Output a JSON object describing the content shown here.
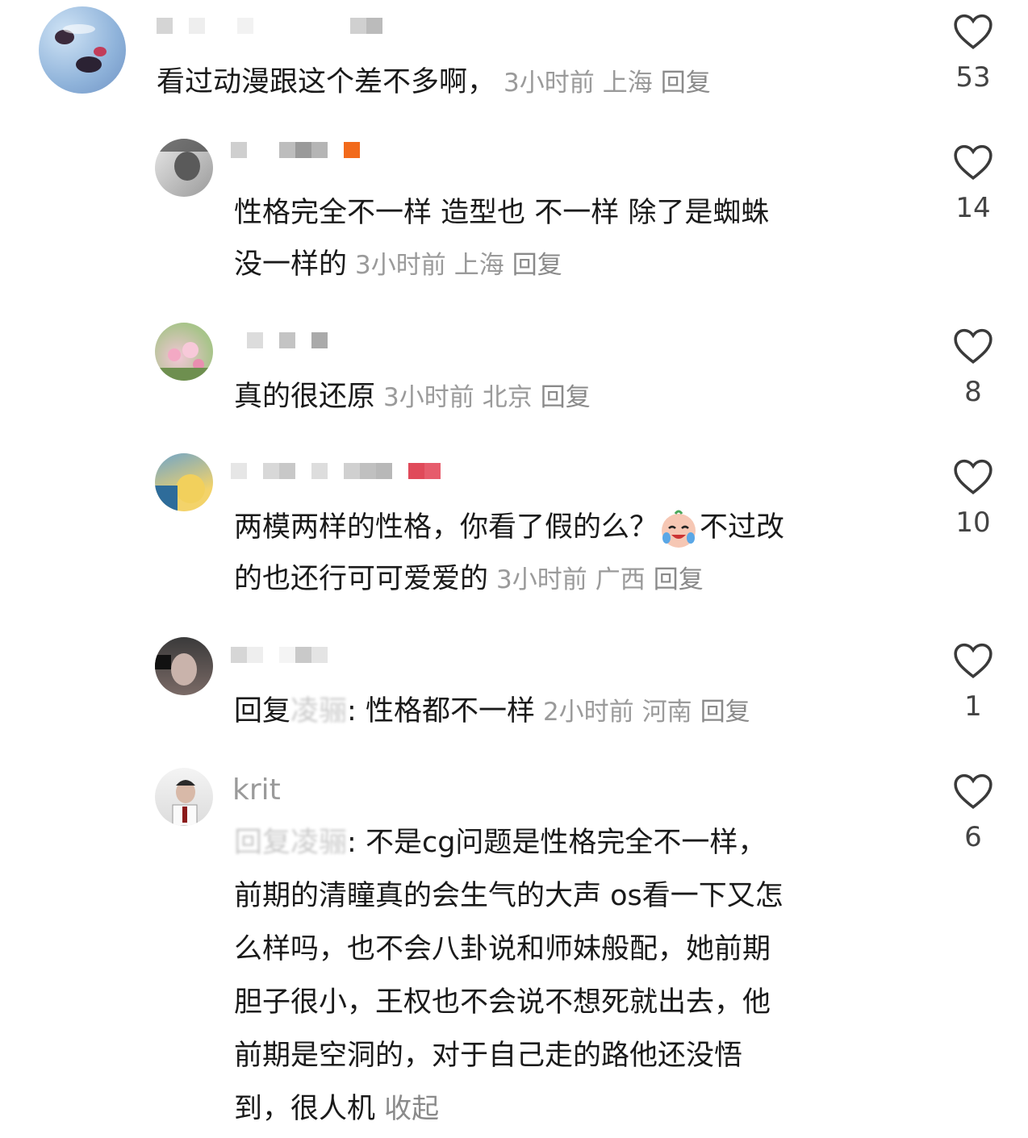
{
  "comments": [
    {
      "username": "",
      "text": "看过动漫跟这个差不多啊，",
      "time": "3小时前",
      "location": "上海",
      "reply_label": "回复",
      "likes": "53"
    },
    {
      "username": "",
      "text_line1": "性格完全不一样 造型也 不一样 除了是蜘蛛",
      "text_line2": "没一样的",
      "time": "3小时前",
      "location": "上海",
      "reply_label": "回复",
      "likes": "14"
    },
    {
      "username": "",
      "text": "真的很还原",
      "time": "3小时前",
      "location": "北京",
      "reply_label": "回复",
      "likes": "8"
    },
    {
      "username": "",
      "text_line1a": "两模两样的性格，你看了假的么？",
      "text_line1b": "不过改",
      "text_line2": "的也还行可可爱爱的",
      "time": "3小时前",
      "location": "广西",
      "reply_label": "回复",
      "likes": "10"
    },
    {
      "username": "",
      "reply_prefix": "回复",
      "reply_target": "凌骊",
      "text": ": 性格都不一样",
      "time": "2小时前",
      "location": "河南",
      "reply_label": "回复",
      "likes": "1"
    },
    {
      "username": "krit",
      "reply_prefix": "回复",
      "reply_target": "凌骊",
      "text_lines": [
        ": 不是cg问题是性格完全不一样，",
        "前期的清瞳真的会生气的大声 os看一下又怎",
        "么样吗，也不会八卦说和师妹般配，她前期",
        "胆子很小，王权也不会说不想死就出去，他",
        "前期是空洞的，对于自己走的路他还没悟",
        "到，很人机"
      ],
      "collapse_label": "收起",
      "likes": "6"
    }
  ],
  "colors": {
    "heart": "#3a3a3a",
    "meta": "#9a9a9a",
    "text": "#1a1a1a"
  }
}
